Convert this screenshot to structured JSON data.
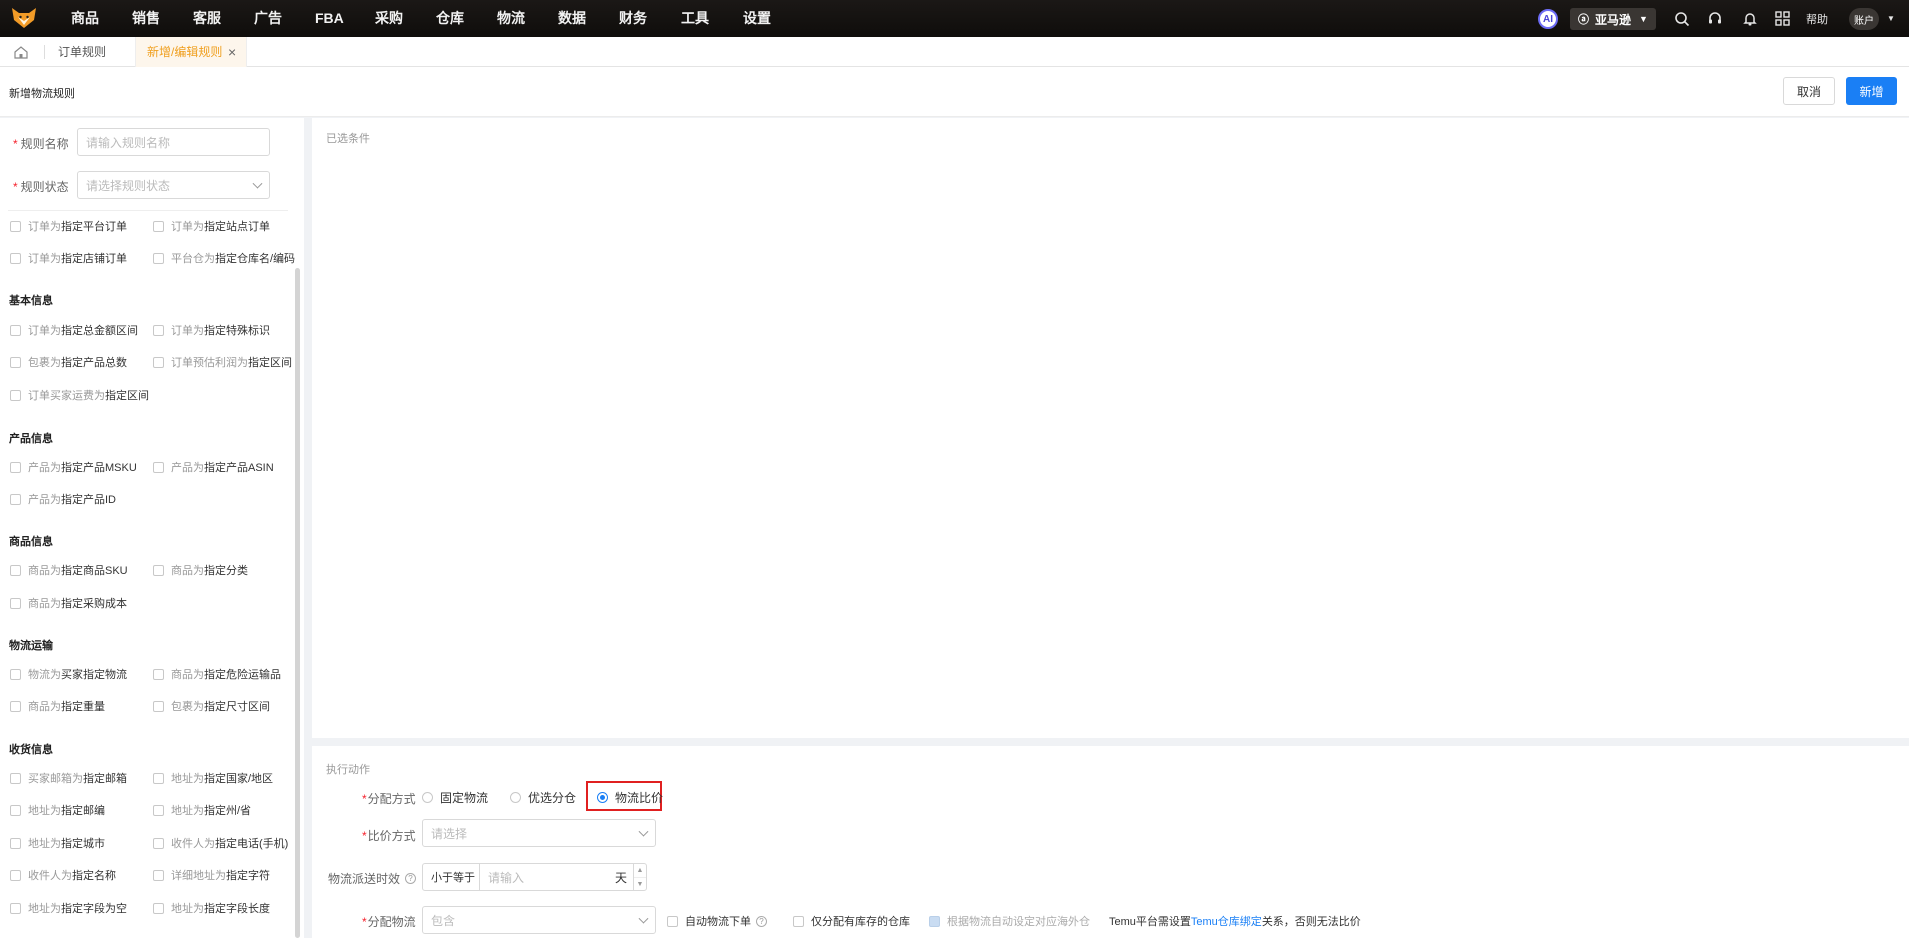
{
  "topbar": {
    "nav": [
      "商品",
      "销售",
      "客服",
      "广告",
      "FBA",
      "采购",
      "仓库",
      "物流",
      "数据",
      "财务",
      "工具",
      "设置"
    ],
    "ai_label": "AI",
    "store": "亚马逊",
    "help": "帮助",
    "account": "账户"
  },
  "tabs": {
    "rules": "订单规则",
    "edit": "新增/编辑规则"
  },
  "header": {
    "title": "新增物流规则",
    "cancel": "取消",
    "add": "新增"
  },
  "form": {
    "name_label": "规则名称",
    "name_placeholder": "请输入规则名称",
    "status_label": "规则状态",
    "status_placeholder": "请选择规则状态"
  },
  "conditions": {
    "top": [
      {
        "pre": "订单为",
        "key": "指定平台订单"
      },
      {
        "pre": "订单为",
        "key": "指定站点订单"
      },
      {
        "pre": "订单为",
        "key": "指定店铺订单"
      },
      {
        "pre": "平台仓为",
        "key": "指定仓库名/编码"
      }
    ],
    "basic_title": "基本信息",
    "basic": [
      {
        "pre": "订单为",
        "key": "指定总金额区间"
      },
      {
        "pre": "订单为",
        "key": "指定特殊标识"
      },
      {
        "pre": "包裹为",
        "key": "指定产品总数"
      },
      {
        "pre": "订单预估利润为",
        "key": "指定区间"
      },
      {
        "pre": "订单买家运费为",
        "key": "指定区间"
      }
    ],
    "product_title": "产品信息",
    "product": [
      {
        "pre": "产品为",
        "key": "指定产品MSKU"
      },
      {
        "pre": "产品为",
        "key": "指定产品ASIN"
      },
      {
        "pre": "产品为",
        "key": "指定产品ID"
      }
    ],
    "goods_title": "商品信息",
    "goods": [
      {
        "pre": "商品为",
        "key": "指定商品SKU"
      },
      {
        "pre": "商品为",
        "key": "指定分类"
      },
      {
        "pre": "商品为",
        "key": "指定采购成本"
      }
    ],
    "ship_title": "物流运输",
    "ship": [
      {
        "pre": "物流为",
        "key": "买家指定物流"
      },
      {
        "pre": "商品为",
        "key": "指定危险运输品"
      },
      {
        "pre": "商品为",
        "key": "指定重量"
      },
      {
        "pre": "包裹为",
        "key": "指定尺寸区间"
      }
    ],
    "recv_title": "收货信息",
    "recv": [
      {
        "pre": "买家邮箱为",
        "key": "指定邮箱"
      },
      {
        "pre": "地址为",
        "key": "指定国家/地区"
      },
      {
        "pre": "地址为",
        "key": "指定邮编"
      },
      {
        "pre": "地址为",
        "key": "指定州/省"
      },
      {
        "pre": "地址为",
        "key": "指定城市"
      },
      {
        "pre": "收件人为",
        "key": "指定电话(手机)"
      },
      {
        "pre": "收件人为",
        "key": "指定名称"
      },
      {
        "pre": "详细地址为",
        "key": "指定字符"
      },
      {
        "pre": "地址为",
        "key": "指定字段为空"
      },
      {
        "pre": "地址为",
        "key": "指定字段长度"
      }
    ]
  },
  "selected": {
    "title": "已选条件"
  },
  "action": {
    "title": "执行动作",
    "alloc_label": "分配方式",
    "alloc_options": [
      "固定物流",
      "优选分仓",
      "物流比价"
    ],
    "alloc_selected": 2,
    "compare_label": "比价方式",
    "compare_placeholder": "请选择",
    "timeliness_label": "物流派送时效",
    "timeliness_op": "小于等于",
    "timeliness_placeholder": "请输入",
    "timeliness_unit": "天",
    "assign_label": "分配物流",
    "assign_placeholder": "包含",
    "auto_order": "自动物流下单",
    "only_stock": "仅分配有库存的仓库",
    "auto_overseas": "根据物流自动设定对应海外仓",
    "temu_pre": "Temu平台需设置",
    "temu_link": "Temu仓库绑定",
    "temu_post": "关系，否则无法比价"
  },
  "colors": {
    "primary": "#1a7ff5",
    "highlight": "#e02020",
    "active_tab": "#f0a020"
  }
}
